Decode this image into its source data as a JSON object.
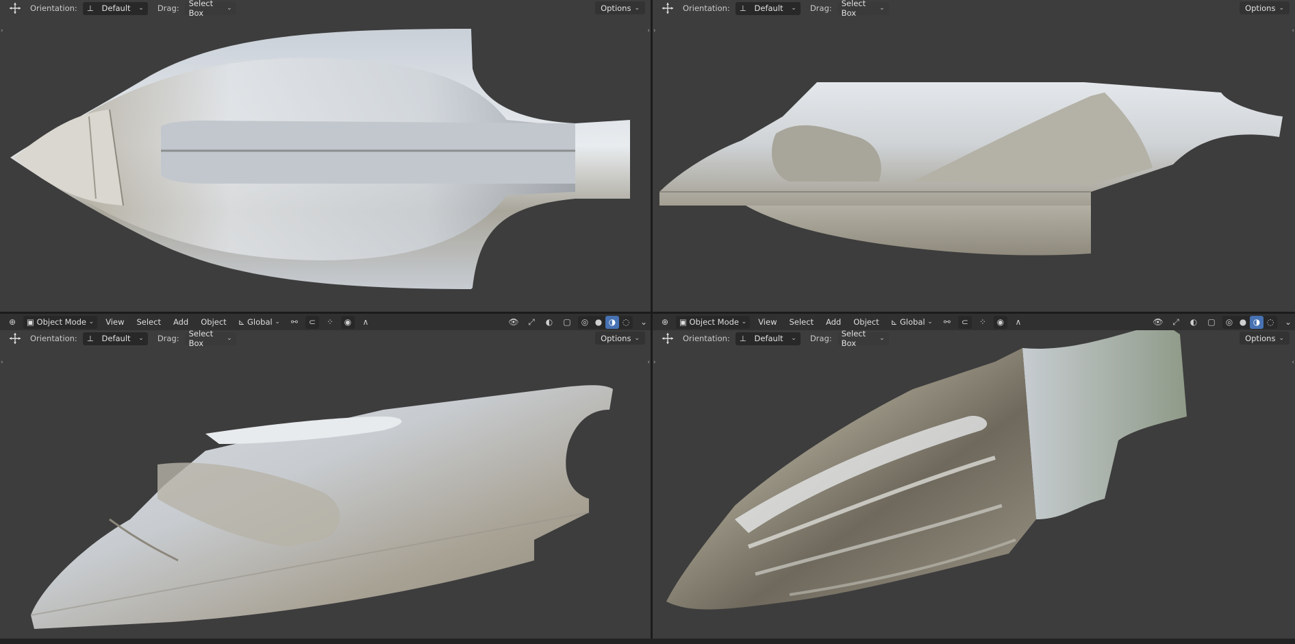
{
  "tool_settings": {
    "orientation_label": "Orientation:",
    "orientation_value": "Default",
    "drag_label": "Drag:",
    "drag_value": "Select Box",
    "options_label": "Options"
  },
  "header": {
    "mode": "Object Mode",
    "menus": [
      "View",
      "Select",
      "Add",
      "Object"
    ],
    "transform_orientation": "Global"
  },
  "colors": {
    "viewport_bg": "#3d3d3d",
    "header_bg": "#303030",
    "accent": "#4772b3"
  },
  "viewports": [
    {
      "id": "top-left",
      "view": "top"
    },
    {
      "id": "top-right",
      "view": "side"
    },
    {
      "id": "bottom-left",
      "view": "perspective"
    },
    {
      "id": "bottom-right",
      "view": "underside"
    }
  ]
}
